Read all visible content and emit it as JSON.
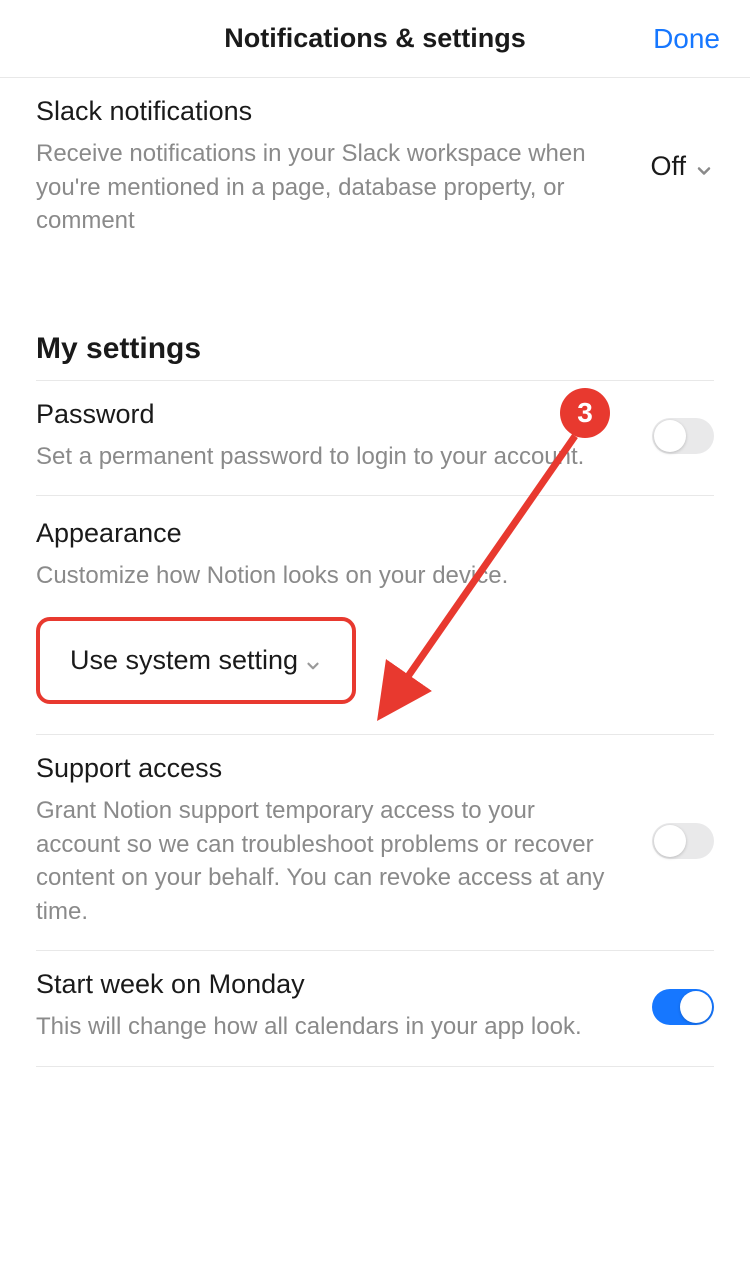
{
  "header": {
    "title": "Notifications & settings",
    "done": "Done"
  },
  "slack": {
    "title": "Slack notifications",
    "desc": "Receive notifications in your Slack workspace when you're mentioned in a page, database property, or comment",
    "value": "Off"
  },
  "section_heading": "My settings",
  "password": {
    "title": "Password",
    "desc": "Set a permanent password to login to your account."
  },
  "appearance": {
    "title": "Appearance",
    "desc": "Customize how Notion looks on your device.",
    "value": "Use system setting"
  },
  "support": {
    "title": "Support access",
    "desc": "Grant Notion support temporary access to your account so we can troubleshoot problems or recover content on your behalf. You can revoke access at any time."
  },
  "start_week": {
    "title": "Start week on Monday",
    "desc": "This will change how all calendars in your app look."
  },
  "annotation": {
    "number": "3"
  }
}
